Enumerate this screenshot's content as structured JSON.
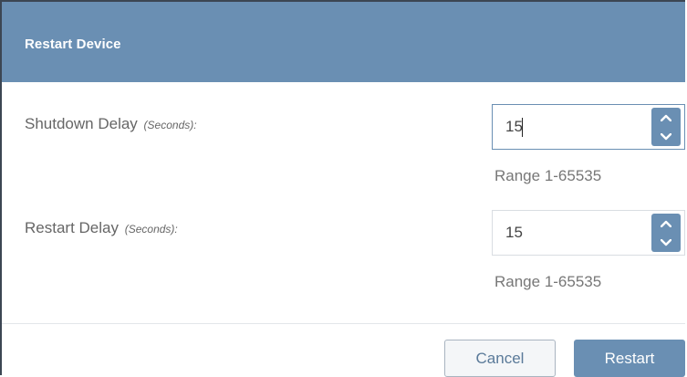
{
  "dialog": {
    "title": "Restart Device"
  },
  "fields": [
    {
      "label": "Shutdown Delay",
      "unit": "(Seconds):",
      "value": "15",
      "range": "Range 1-65535"
    },
    {
      "label": "Restart Delay",
      "unit": "(Seconds):",
      "value": "15",
      "range": "Range 1-65535"
    }
  ],
  "buttons": {
    "cancel": "Cancel",
    "restart": "Restart"
  },
  "icons": {
    "spin_up": "chevron-up-icon",
    "spin_down": "chevron-down-icon"
  },
  "colors": {
    "header": "#6a8fb3",
    "accent": "#6a8fb3"
  }
}
